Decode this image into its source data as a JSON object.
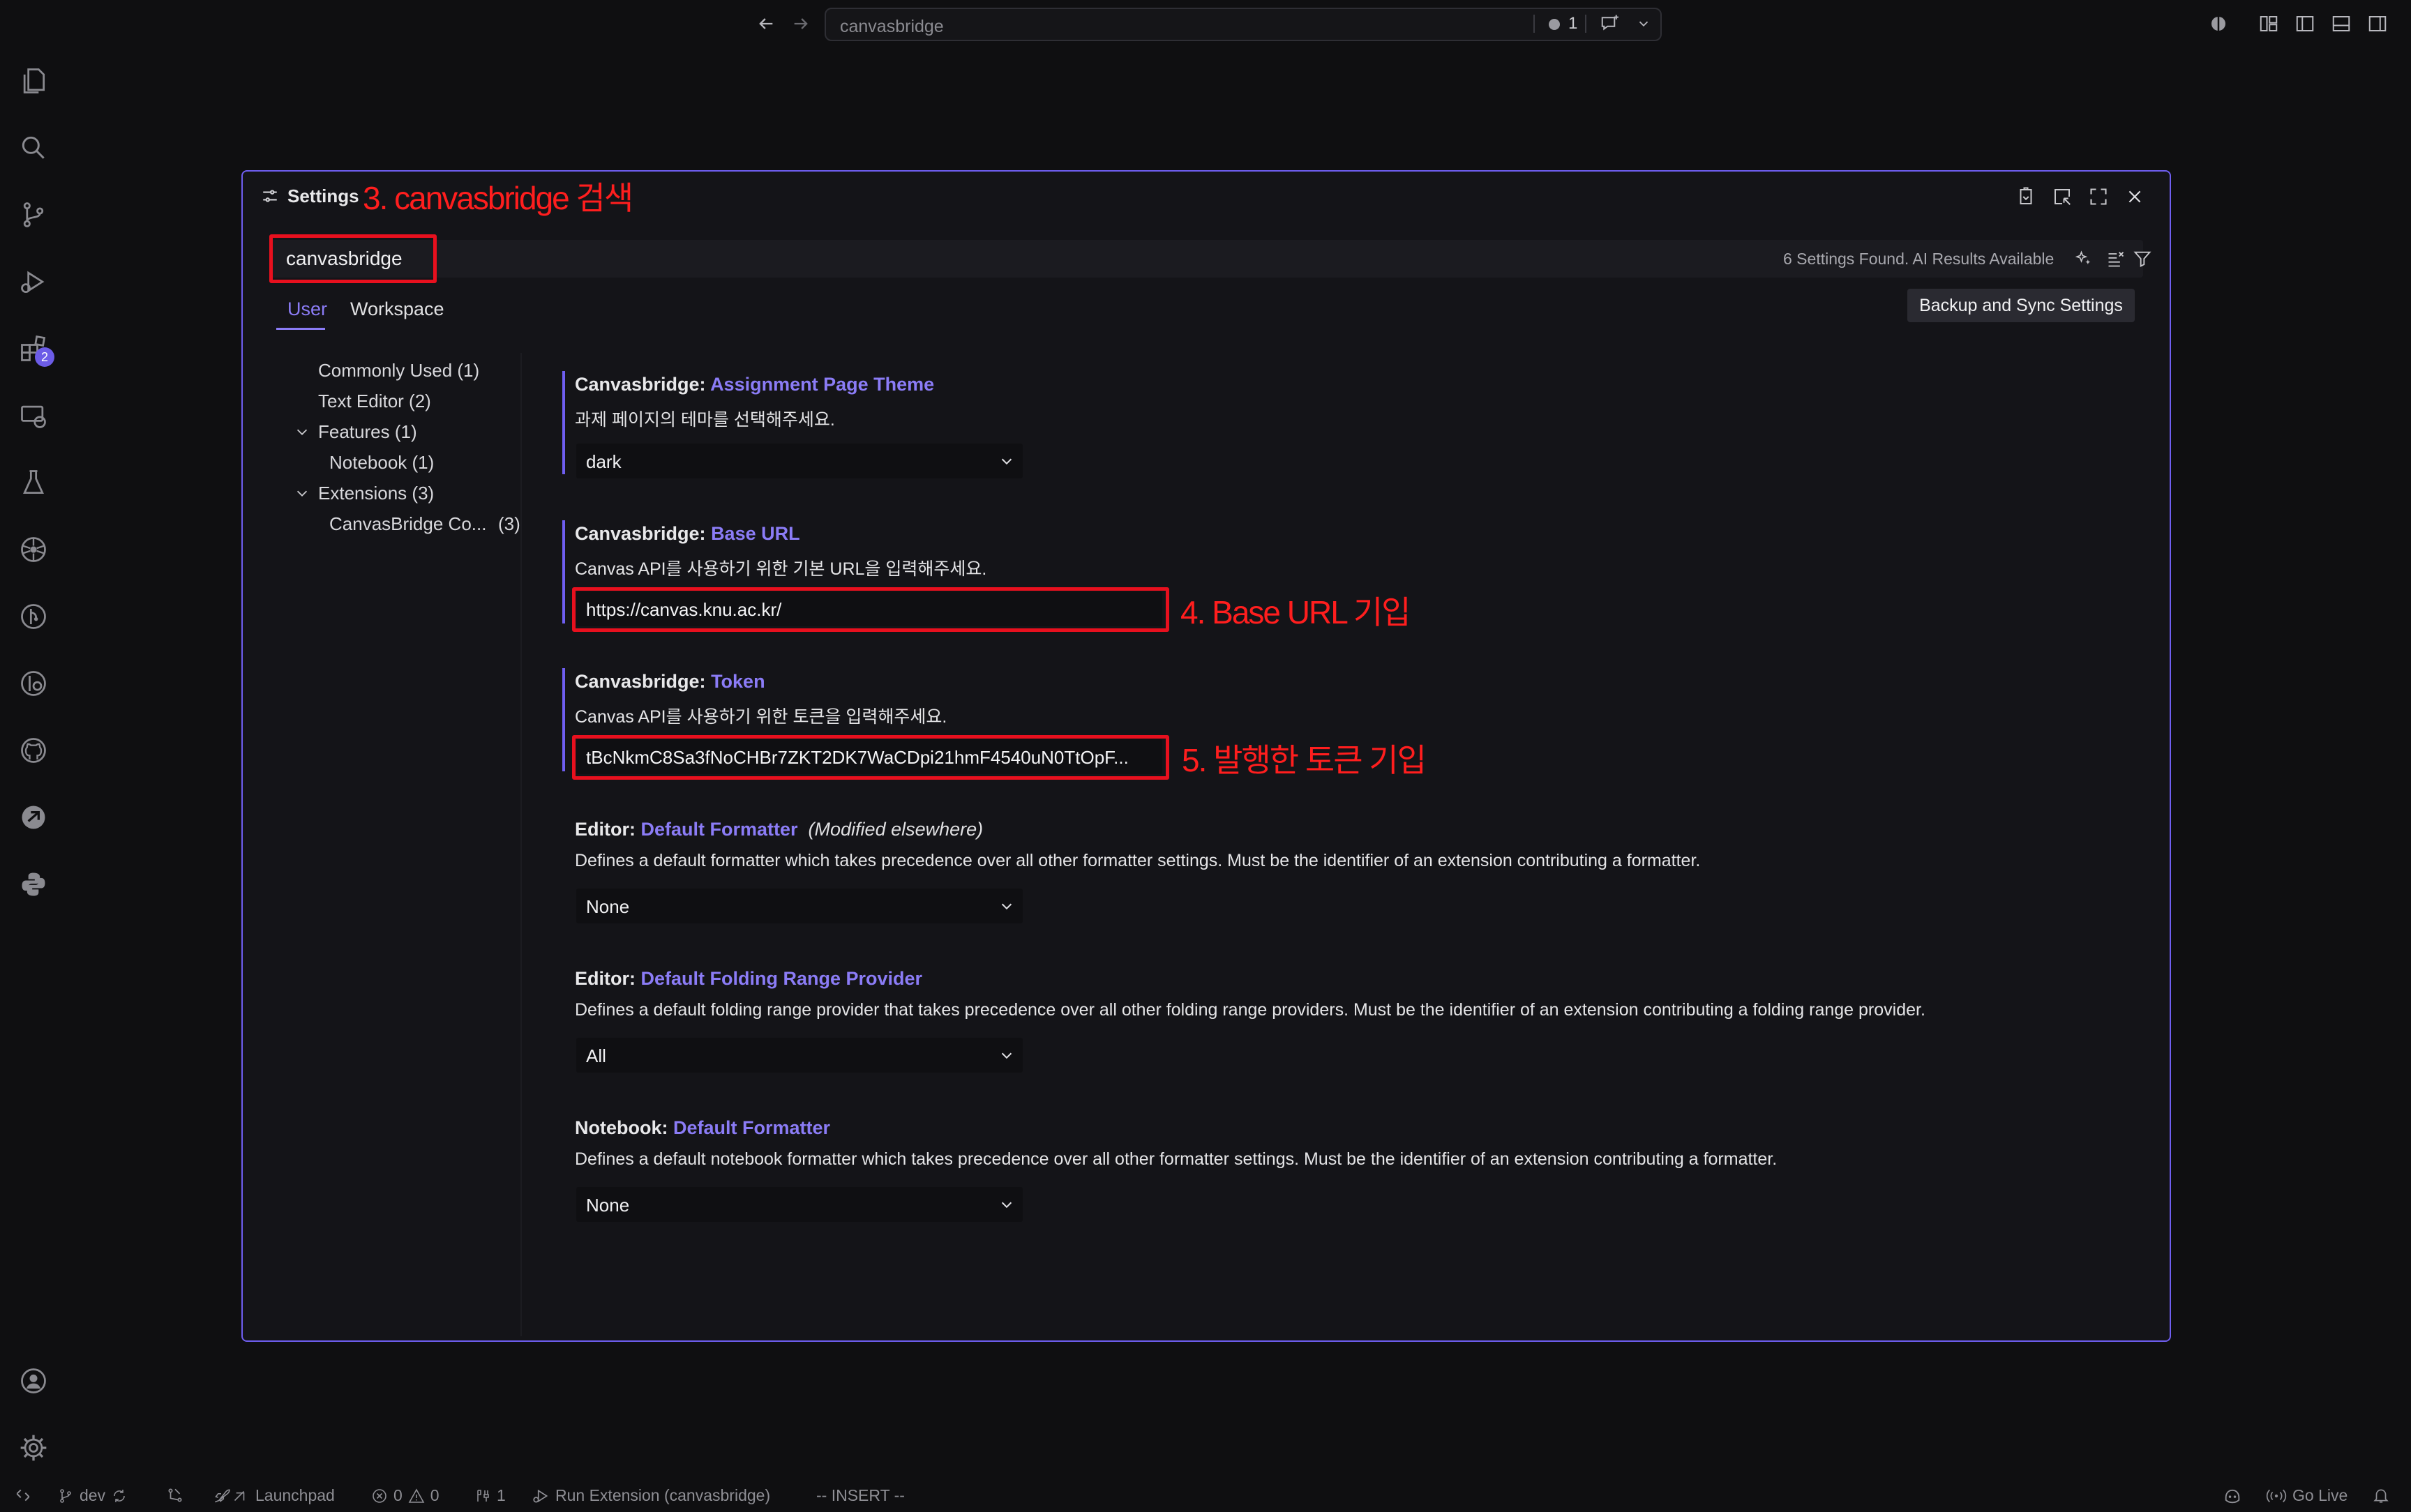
{
  "titlebar": {
    "command_center_text": "canvasbridge",
    "notification_count": "1"
  },
  "activitybar": {
    "extensions_badge": "2"
  },
  "settings": {
    "title": "Settings",
    "search_value": "canvasbridge",
    "search_result_text": "6 Settings Found. AI Results Available",
    "tabs": {
      "user": "User",
      "workspace": "Workspace"
    },
    "sync_button": "Backup and Sync Settings",
    "toc": {
      "commonly_used": "Commonly Used (1)",
      "text_editor": "Text Editor (2)",
      "features": "Features (1)",
      "notebook": "Notebook (1)",
      "extensions": "Extensions (3)",
      "canvasbridge": "CanvasBridge Co...",
      "canvasbridge_count": "(3)"
    },
    "items": [
      {
        "prefix": "Canvasbridge: ",
        "key": "Assignment Page Theme",
        "modified": "",
        "description": "과제 페이지의 테마를 선택해주세요.",
        "value": "dark"
      },
      {
        "prefix": "Canvasbridge: ",
        "key": "Base URL",
        "modified": "",
        "description": "Canvas API를 사용하기 위한 기본 URL을 입력해주세요.",
        "value": "https://canvas.knu.ac.kr/"
      },
      {
        "prefix": "Canvasbridge: ",
        "key": "Token",
        "modified": "",
        "description": "Canvas API를 사용하기 위한 토큰을 입력해주세요.",
        "value": "tBcNkmC8Sa3fNoCHBr7ZKT2DK7WaCDpi21hmF4540uN0TtOpF..."
      },
      {
        "prefix": "Editor: ",
        "key": "Default Formatter",
        "modified": "(Modified elsewhere)",
        "description": "Defines a default formatter which takes precedence over all other formatter settings. Must be the identifier of an extension contributing a formatter.",
        "value": "None"
      },
      {
        "prefix": "Editor: ",
        "key": "Default Folding Range Provider",
        "modified": "",
        "description": "Defines a default folding range provider that takes precedence over all other folding range providers. Must be the identifier of an extension contributing a folding range provider.",
        "value": "All"
      },
      {
        "prefix": "Notebook: ",
        "key": "Default Formatter",
        "modified": "",
        "description": "Defines a default notebook formatter which takes precedence over all other formatter settings. Must be the identifier of an extension contributing a formatter.",
        "value": "None"
      }
    ]
  },
  "annotations": {
    "step3": "3. canvasbridge 검색",
    "step4": "4. Base URL 기입",
    "step5": "5. 발행한 토큰 기입"
  },
  "statusbar": {
    "branch": "dev",
    "launchpad": "Launchpad",
    "errors": "0",
    "warnings": "0",
    "ports": "1",
    "run": "Run Extension (canvasbridge)",
    "mode": "-- INSERT --",
    "go_live": "Go Live"
  },
  "colors": {
    "accent": "#8b7cf6",
    "panel_border": "#6f5ef0",
    "annotation_red": "#ff1e1e",
    "background": "#0f0f11"
  }
}
